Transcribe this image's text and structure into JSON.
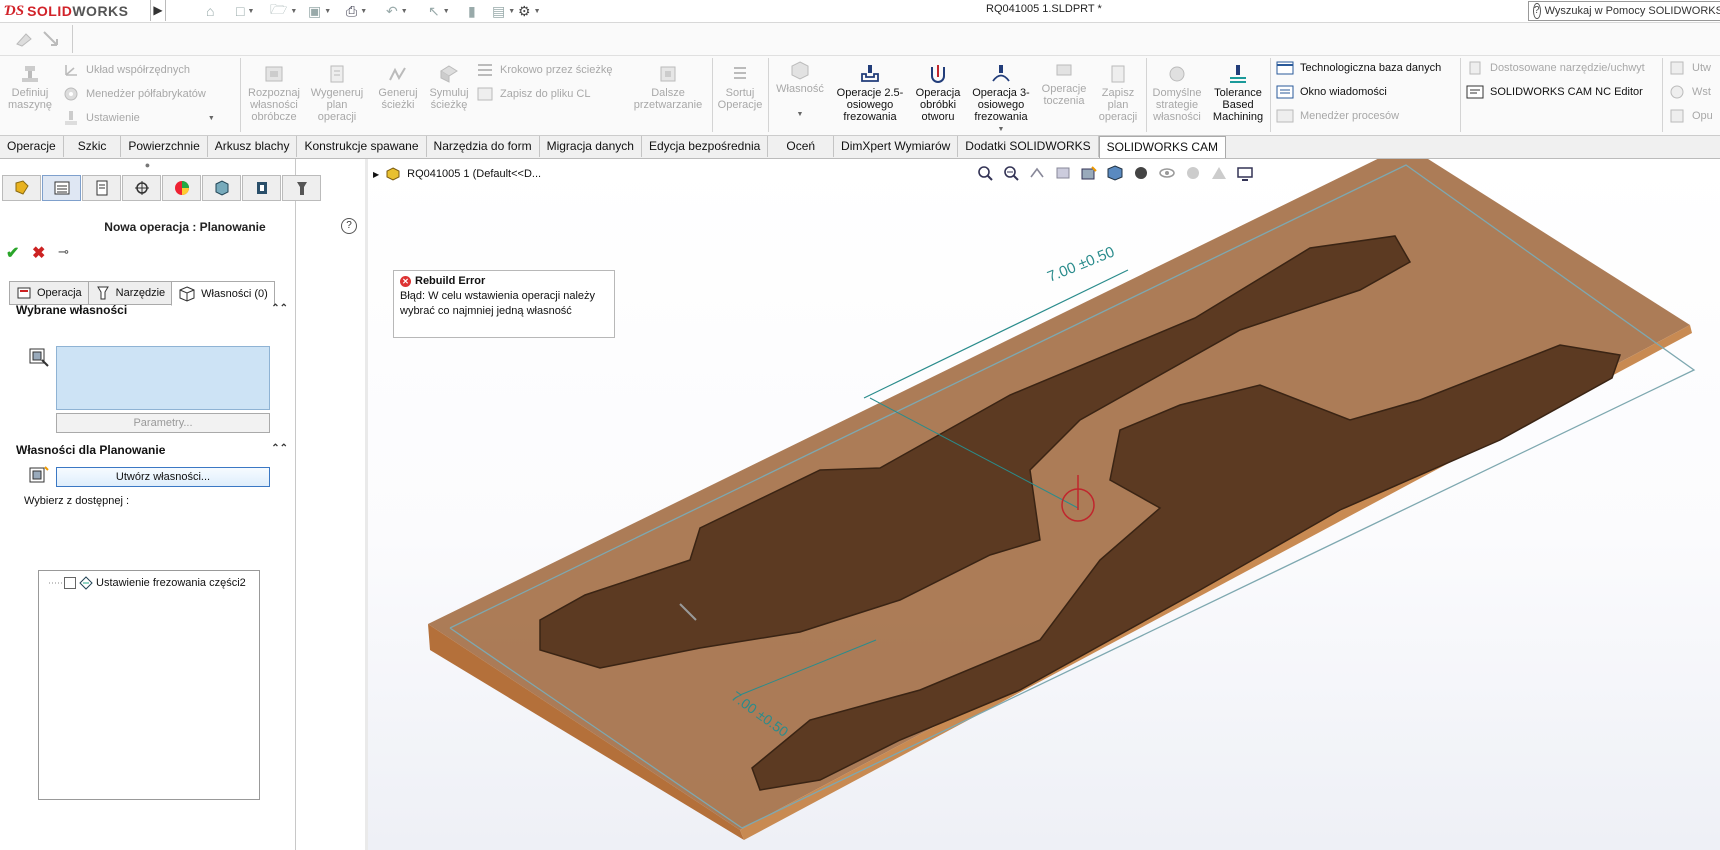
{
  "app": {
    "logo_ds": "ƊS",
    "logo_solid": "SOLID",
    "logo_works": "WORKS",
    "document_title": "RQ041005 1.SLDPRT *",
    "help_search_placeholder": "Wyszukaj w Pomocy SOLIDWORKS"
  },
  "ribbon": {
    "coords_group": {
      "define_machine": "Definiuj maszynę",
      "coord_system": "Układ współrzędnych",
      "stock_manager": "Menedżer półfabrykatów",
      "setup": "Ustawienie"
    },
    "feature_group": {
      "recognize": "Rozpoznaj własności obróbcze",
      "generate_plan": "Wygeneruj plan operacji",
      "generate_path": "Generuj ścieżki",
      "simulate": "Symuluj ścieżkę",
      "step_through": "Krokowo przez ścieżkę",
      "save_cl": "Zapisz do pliku CL",
      "post_process": "Dalsze przetwarzanie",
      "sort_ops": "Sortuj Operacje"
    },
    "ops_group": {
      "feature": "Własność",
      "op_25axis": "Operacje 2.5-osiowego frezowania",
      "op_hole": "Operacja obróbki otworu",
      "op_3axis": "Operacja 3-osiowego frezowania",
      "op_turning": "Operacje toczenia",
      "save_plan": "Zapisz plan operacji",
      "default_strategy": "Domyślne strategie własności",
      "tbm": "Tolerance Based Machining"
    },
    "db_group": {
      "tech_db": "Technologiczna baza danych",
      "msg_window": "Okno wiadomości",
      "process_mgr": "Menedżer procesów",
      "custom_tool": "Dostosowane narzędzie/uchwyt",
      "nc_editor": "SOLIDWORKS CAM NC Editor",
      "utw": "Utw",
      "wst": "Wst",
      "opu": "Opu"
    }
  },
  "tabs": [
    {
      "label": "Operacje",
      "active": false
    },
    {
      "label": "Szkic",
      "active": false
    },
    {
      "label": "Powierzchnie",
      "active": false
    },
    {
      "label": "Arkusz blachy",
      "active": false
    },
    {
      "label": "Konstrukcje spawane",
      "active": false
    },
    {
      "label": "Narzędzia do form",
      "active": false
    },
    {
      "label": "Migracja danych",
      "active": false
    },
    {
      "label": "Edycja bezpośrednia",
      "active": false
    },
    {
      "label": "Oceń",
      "active": false
    },
    {
      "label": "DimXpert Wymiarów",
      "active": false
    },
    {
      "label": "Dodatki SOLIDWORKS",
      "active": false
    },
    {
      "label": "SOLIDWORKS CAM",
      "active": true
    }
  ],
  "panel": {
    "title": "Nowa operacja : Planowanie",
    "subtabs": {
      "operation": "Operacja",
      "tool": "Narzędzie",
      "features": "Własności (0)"
    },
    "selected_section": "Wybrane własności",
    "params_button": "Parametry...",
    "features_section": "Własności dla Planowanie",
    "create_button": "Utwórz własności...",
    "choose_label": "Wybierz z dostępnej :",
    "tree_item": "Ustawienie frezowania części2"
  },
  "viewport": {
    "tree_root": "RQ041005 1  (Default<<D...",
    "error_title": "Rebuild Error",
    "error_message": "Błąd: W celu wstawienia operacji należy wybrać co najmniej jedną własność",
    "dimension_1": "7.00 ±0.50",
    "dimension_2": "7.00 ±0.50"
  },
  "colors": {
    "accent": "#2a8c8c",
    "stock": "#a0683e",
    "part": "#5a3a22",
    "selection_box": "#cde3f5",
    "brand": "#d2232a"
  }
}
